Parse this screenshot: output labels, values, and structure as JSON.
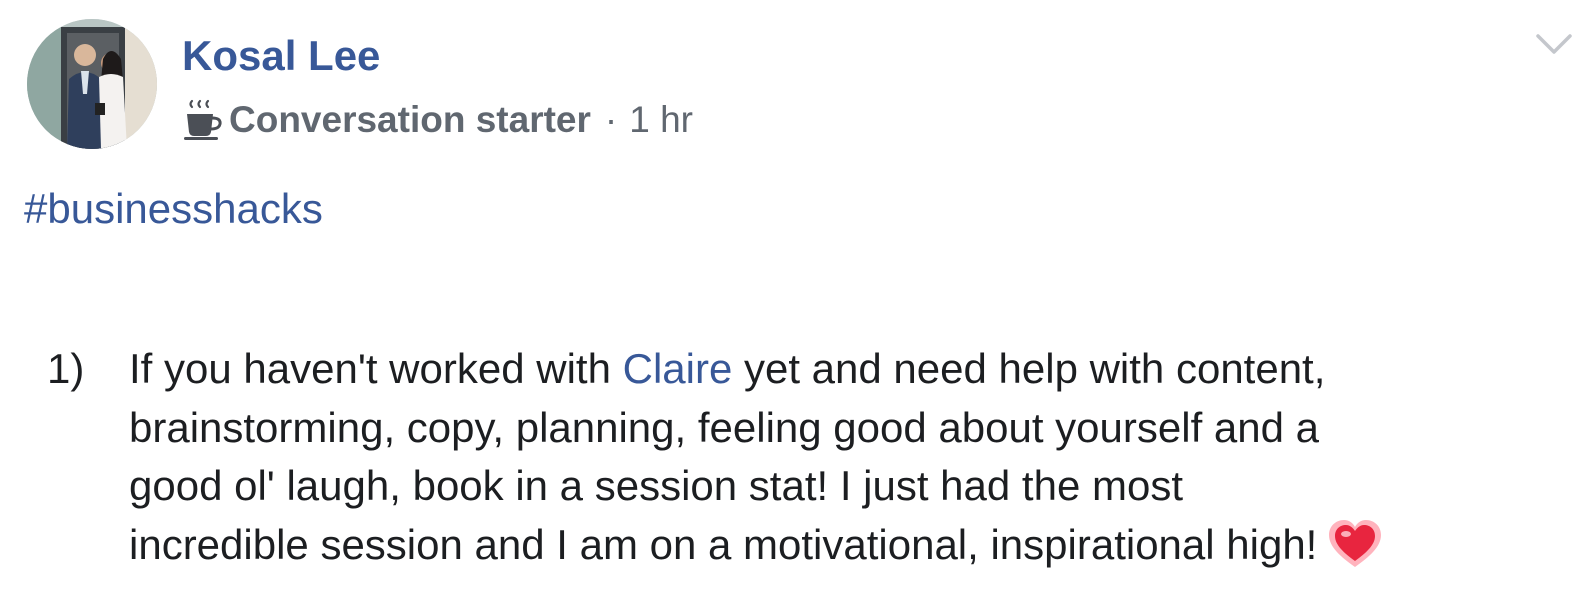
{
  "post": {
    "author": "Kosal Lee",
    "badge": {
      "icon": "coffee-cup-icon",
      "label": "Conversation starter"
    },
    "separator": "·",
    "timestamp": "1 hr",
    "menu_icon": "chevron-down-icon",
    "hashtag": "#businesshacks",
    "list": {
      "number": "1)",
      "line1_before": "If you haven't worked with ",
      "mention": "Claire",
      "line1_after": " yet and need help with content,",
      "line2": "brainstorming, copy, planning, feeling good about yourself and a",
      "line3": "good ol' laugh, book in a session stat! I just had the most",
      "line4": "incredible session and I am on a motivational, inspirational high!",
      "emoji": "heart-emoji"
    }
  },
  "colors": {
    "link": "#385898",
    "text": "#1c1e21",
    "meta": "#606770",
    "heart": "#e8253f"
  }
}
